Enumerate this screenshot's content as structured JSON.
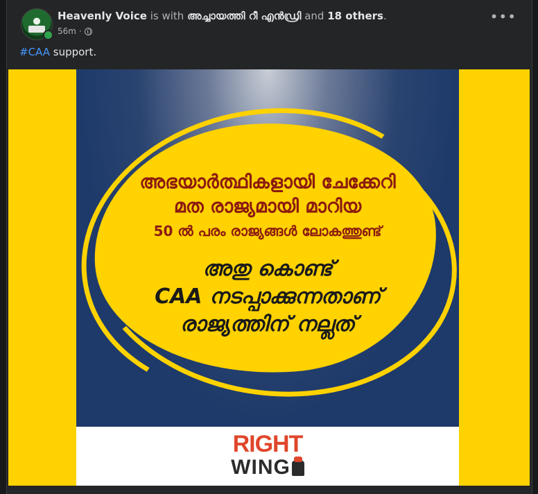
{
  "post": {
    "author": "Heavenly Voice",
    "with_text": "is with",
    "tagged": "അച്ചായത്തി റീ എൻഡ്രി",
    "and_text": "and",
    "others": "18 others",
    "period": ".",
    "time": "56m",
    "dot": "·",
    "more": "•••",
    "hashtag": "#CAA",
    "caption_rest": " support."
  },
  "image": {
    "line1": "അഭയാർത്ഥികളായി ചേക്കേറി",
    "line2": "മത രാജ്യമായി മാറിയ",
    "line3": "50 ൽ പരം രാജ്യങ്ങൾ ലോകത്തുണ്ട്",
    "line4": "അതു കൊണ്ട്",
    "line5": "CAA നടപ്പാക്കുന്നതാണ്",
    "line6": "രാജ്യത്തിന് നല്ലത്",
    "logo_top": "RIGHT",
    "logo_bottom": "WING"
  }
}
